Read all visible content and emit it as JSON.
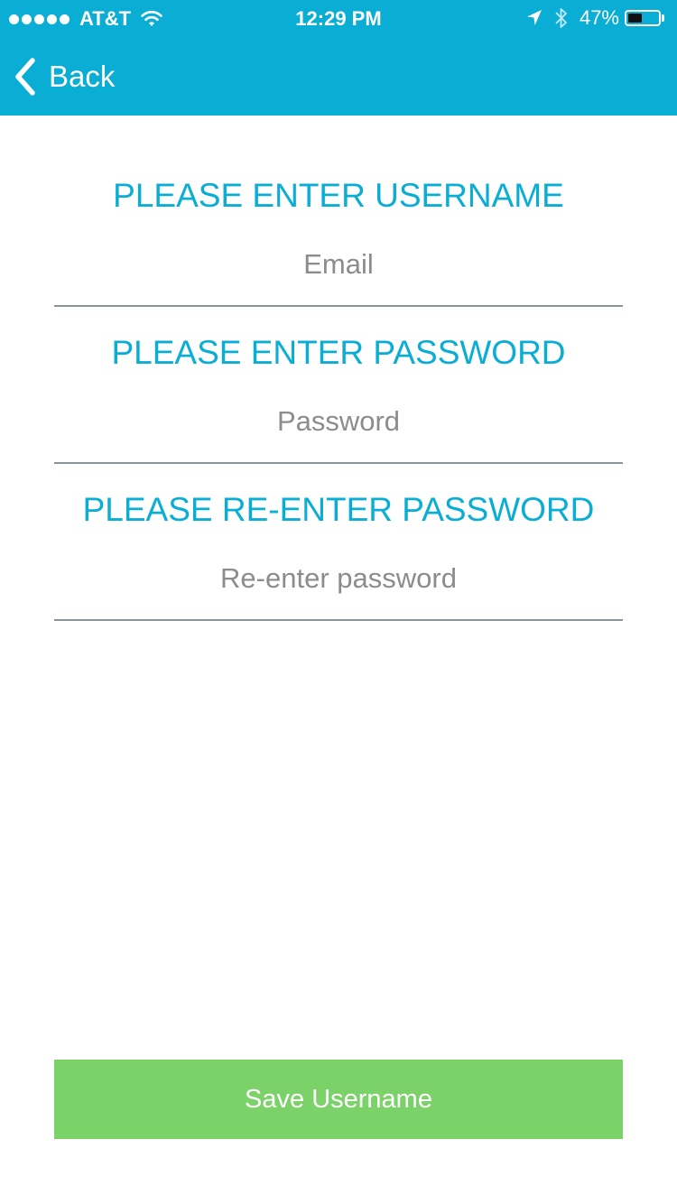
{
  "status_bar": {
    "carrier": "AT&T",
    "time": "12:29 PM",
    "battery_percent": "47%",
    "battery_level": 0.47,
    "signal_bars": 5,
    "icons": [
      "signal-dots-icon",
      "wifi-icon",
      "location-arrow-icon",
      "bluetooth-icon",
      "battery-icon"
    ]
  },
  "nav": {
    "back_label": "Back",
    "back_icon": "chevron-left-icon"
  },
  "form": {
    "username": {
      "heading": "PLEASE ENTER USERNAME",
      "placeholder": "Email",
      "value": ""
    },
    "password": {
      "heading": "PLEASE ENTER PASSWORD",
      "placeholder": "Password",
      "value": ""
    },
    "confirm_password": {
      "heading": "PLEASE RE-ENTER PASSWORD",
      "placeholder": "Re-enter password",
      "value": ""
    }
  },
  "actions": {
    "save_label": "Save Username"
  },
  "colors": {
    "accent": "#0aadd4",
    "button": "#7ad268",
    "underline": "#8a9396",
    "placeholder": "#8c8c8c"
  }
}
